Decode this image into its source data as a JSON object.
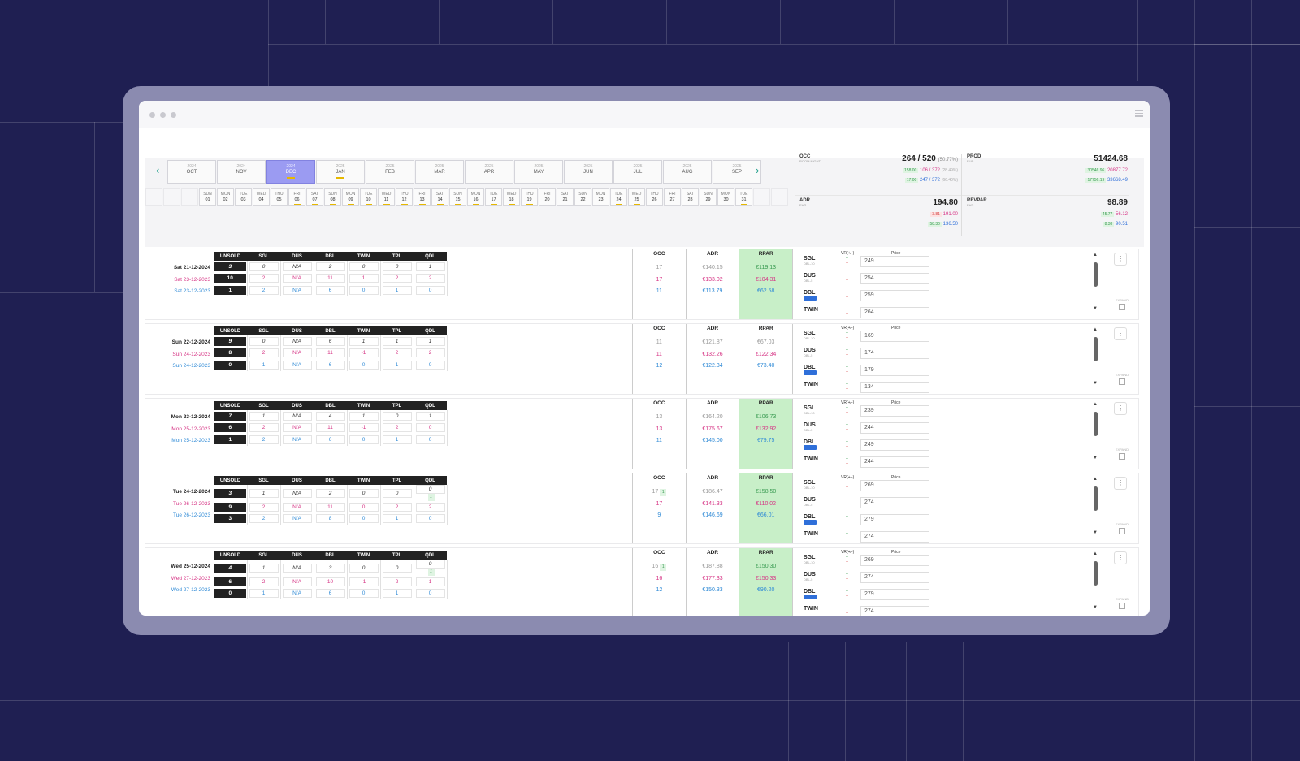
{
  "months": [
    {
      "year": "2024",
      "label": "OCT",
      "active": false,
      "indicator": false
    },
    {
      "year": "2024",
      "label": "NOV",
      "active": false,
      "indicator": false
    },
    {
      "year": "2024",
      "label": "DEC",
      "active": true,
      "indicator": true
    },
    {
      "year": "2025",
      "label": "JAN",
      "active": false,
      "indicator": true
    },
    {
      "year": "2025",
      "label": "FEB",
      "active": false,
      "indicator": false
    },
    {
      "year": "2025",
      "label": "MAR",
      "active": false,
      "indicator": false
    },
    {
      "year": "2025",
      "label": "APR",
      "active": false,
      "indicator": false
    },
    {
      "year": "2025",
      "label": "MAY",
      "active": false,
      "indicator": false
    },
    {
      "year": "2025",
      "label": "JUN",
      "active": false,
      "indicator": false
    },
    {
      "year": "2025",
      "label": "JUL",
      "active": false,
      "indicator": false
    },
    {
      "year": "2025",
      "label": "AUG",
      "active": false,
      "indicator": false
    },
    {
      "year": "2025",
      "label": "SEP",
      "active": false,
      "indicator": false
    }
  ],
  "days": [
    {
      "w": "",
      "n": "",
      "dim": true
    },
    {
      "w": "",
      "n": "",
      "dim": true
    },
    {
      "w": "",
      "n": "",
      "dim": true
    },
    {
      "w": "SUN",
      "n": "01"
    },
    {
      "w": "MON",
      "n": "02"
    },
    {
      "w": "TUE",
      "n": "03"
    },
    {
      "w": "WED",
      "n": "04"
    },
    {
      "w": "THU",
      "n": "05"
    },
    {
      "w": "FRI",
      "n": "06",
      "ind": true
    },
    {
      "w": "SAT",
      "n": "07",
      "ind": true
    },
    {
      "w": "SUN",
      "n": "08",
      "ind": true
    },
    {
      "w": "MON",
      "n": "09",
      "ind": true
    },
    {
      "w": "TUE",
      "n": "10",
      "ind": true
    },
    {
      "w": "WED",
      "n": "11",
      "ind": true
    },
    {
      "w": "THU",
      "n": "12",
      "ind": true
    },
    {
      "w": "FRI",
      "n": "13",
      "ind": true
    },
    {
      "w": "SAT",
      "n": "14",
      "ind": true
    },
    {
      "w": "SUN",
      "n": "15",
      "ind": true
    },
    {
      "w": "MON",
      "n": "16",
      "ind": true
    },
    {
      "w": "TUE",
      "n": "17",
      "ind": true
    },
    {
      "w": "WED",
      "n": "18",
      "ind": true
    },
    {
      "w": "THU",
      "n": "19",
      "ind": true
    },
    {
      "w": "FRI",
      "n": "20"
    },
    {
      "w": "SAT",
      "n": "21"
    },
    {
      "w": "SUN",
      "n": "22"
    },
    {
      "w": "MON",
      "n": "23"
    },
    {
      "w": "TUE",
      "n": "24",
      "ind": true
    },
    {
      "w": "WED",
      "n": "25",
      "ind": true
    },
    {
      "w": "THU",
      "n": "26"
    },
    {
      "w": "FRI",
      "n": "27"
    },
    {
      "w": "SAT",
      "n": "28"
    },
    {
      "w": "SUN",
      "n": "29"
    },
    {
      "w": "MON",
      "n": "30"
    },
    {
      "w": "TUE",
      "n": "31",
      "ind": true
    },
    {
      "w": "",
      "n": "",
      "dim": true
    },
    {
      "w": "",
      "n": "",
      "dim": true
    }
  ],
  "kpis": {
    "occ": {
      "label": "OCC",
      "sub": "ROOM NIGHT",
      "value": "264 / 520",
      "pct": "(50.77%)",
      "cmp1_delta": "158.00",
      "cmp1": "106 / 372",
      "cmp1_pct": "(28.49%)",
      "cmp2_delta": "17.00",
      "cmp2": "247 / 372",
      "cmp2_pct": "(66.40%)"
    },
    "prod": {
      "label": "PROD",
      "sub": "EUR",
      "value": "51424.68",
      "cmp1_delta": "30546.96",
      "cmp1": "20877.72",
      "cmp2_delta": "17756.19",
      "cmp2": "33668.49"
    },
    "adr": {
      "label": "ADR",
      "sub": "EUR",
      "value": "194.80",
      "cmp1_delta": "3.81",
      "cmp1": "191.00",
      "cmp2_delta": "58.30",
      "cmp2": "136.50"
    },
    "revpar": {
      "label": "REVPAR",
      "sub": "EUR",
      "value": "98.89",
      "cmp1_delta": "45.77",
      "cmp1": "56.12",
      "cmp2_delta": "8.38",
      "cmp2": "90.51"
    }
  },
  "table_headers": [
    "UNSOLD",
    "SGL",
    "DUS",
    "DBL",
    "TWIN",
    "TPL",
    "QDL"
  ],
  "metric_headers": [
    "OCC",
    "ADR",
    "RPAR"
  ],
  "pricing_headers": {
    "vr": "VR(+/-)",
    "price": "Price"
  },
  "expand_label": "EXPAND",
  "room_types": [
    "SGL",
    "DUS",
    "DBL",
    "TWIN"
  ],
  "room_subs": [
    "DBL-10",
    "DBL-5",
    "",
    ""
  ],
  "rows": [
    {
      "dates": [
        "Sat 21-12-2024",
        "Sat 23-12-2023",
        "Sat 23-12-2023"
      ],
      "inv": [
        [
          "3",
          "0",
          "N/A",
          "2",
          "0",
          "0",
          "1"
        ],
        [
          "10",
          "2",
          "N/A",
          "11",
          "1",
          "2",
          "2"
        ],
        [
          "1",
          "2",
          "N/A",
          "6",
          "0",
          "1",
          "0"
        ]
      ],
      "occ": [
        "17",
        "17",
        "11"
      ],
      "adr": [
        "€140.15",
        "€133.02",
        "€113.79"
      ],
      "rpar": [
        "€119.13",
        "€104.31",
        "€62.58"
      ],
      "prices": [
        "249",
        "254",
        "259",
        "264"
      ],
      "rpar_green": true
    },
    {
      "dates": [
        "Sun 22-12-2024",
        "Sun 24-12-2023",
        "Sun 24-12-2023"
      ],
      "inv": [
        [
          "9",
          "0",
          "N/A",
          "6",
          "1",
          "1",
          "1"
        ],
        [
          "8",
          "2",
          "N/A",
          "11",
          "-1",
          "2",
          "2"
        ],
        [
          "0",
          "1",
          "N/A",
          "6",
          "0",
          "1",
          "0"
        ]
      ],
      "occ": [
        "11",
        "11",
        "12"
      ],
      "adr": [
        "€121.87",
        "€132.26",
        "€122.34"
      ],
      "rpar": [
        "€67.03",
        "€122.34",
        "€73.40"
      ],
      "prices": [
        "169",
        "174",
        "179",
        "134"
      ],
      "rpar_green": false
    },
    {
      "dates": [
        "Mon 23-12-2024",
        "Mon 25-12-2023",
        "Mon 25-12-2023"
      ],
      "inv": [
        [
          "7",
          "1",
          "N/A",
          "4",
          "1",
          "0",
          "1"
        ],
        [
          "6",
          "2",
          "N/A",
          "11",
          "-1",
          "2",
          "0"
        ],
        [
          "1",
          "2",
          "N/A",
          "6",
          "0",
          "1",
          "0"
        ]
      ],
      "occ": [
        "13",
        "13",
        "11"
      ],
      "adr": [
        "€164.20",
        "€175.67",
        "€145.00"
      ],
      "rpar": [
        "€106.73",
        "€132.92",
        "€79.75"
      ],
      "prices": [
        "239",
        "244",
        "249",
        "244"
      ],
      "rpar_green": true
    },
    {
      "dates": [
        "Tue 24-12-2024",
        "Tue 26-12-2023",
        "Tue 26-12-2023"
      ],
      "inv": [
        [
          "3",
          "1",
          "N/A",
          "2",
          "0",
          "0",
          "0"
        ],
        [
          "9",
          "2",
          "N/A",
          "11",
          "0",
          "2",
          "2"
        ],
        [
          "3",
          "2",
          "N/A",
          "8",
          "0",
          "1",
          "0"
        ]
      ],
      "occ": [
        "17",
        "17",
        "9"
      ],
      "adr": [
        "€186.47",
        "€141.33",
        "€146.69"
      ],
      "rpar": [
        "€158.50",
        "€110.02",
        "€66.01"
      ],
      "prices": [
        "269",
        "274",
        "279",
        "274"
      ],
      "rpar_green": true,
      "extra": "1"
    },
    {
      "dates": [
        "Wed 25-12-2024",
        "Wed 27-12-2023",
        "Wed 27-12-2023"
      ],
      "inv": [
        [
          "4",
          "1",
          "N/A",
          "3",
          "0",
          "0",
          "0"
        ],
        [
          "6",
          "2",
          "N/A",
          "10",
          "-1",
          "2",
          "1"
        ],
        [
          "0",
          "1",
          "N/A",
          "6",
          "0",
          "1",
          "0"
        ]
      ],
      "occ": [
        "16",
        "16",
        "12"
      ],
      "adr": [
        "€187.88",
        "€177.33",
        "€150.33"
      ],
      "rpar": [
        "€150.30",
        "€150.33",
        "€90.20"
      ],
      "prices": [
        "269",
        "274",
        "279",
        "274"
      ],
      "rpar_green": true,
      "extra": "1"
    }
  ]
}
